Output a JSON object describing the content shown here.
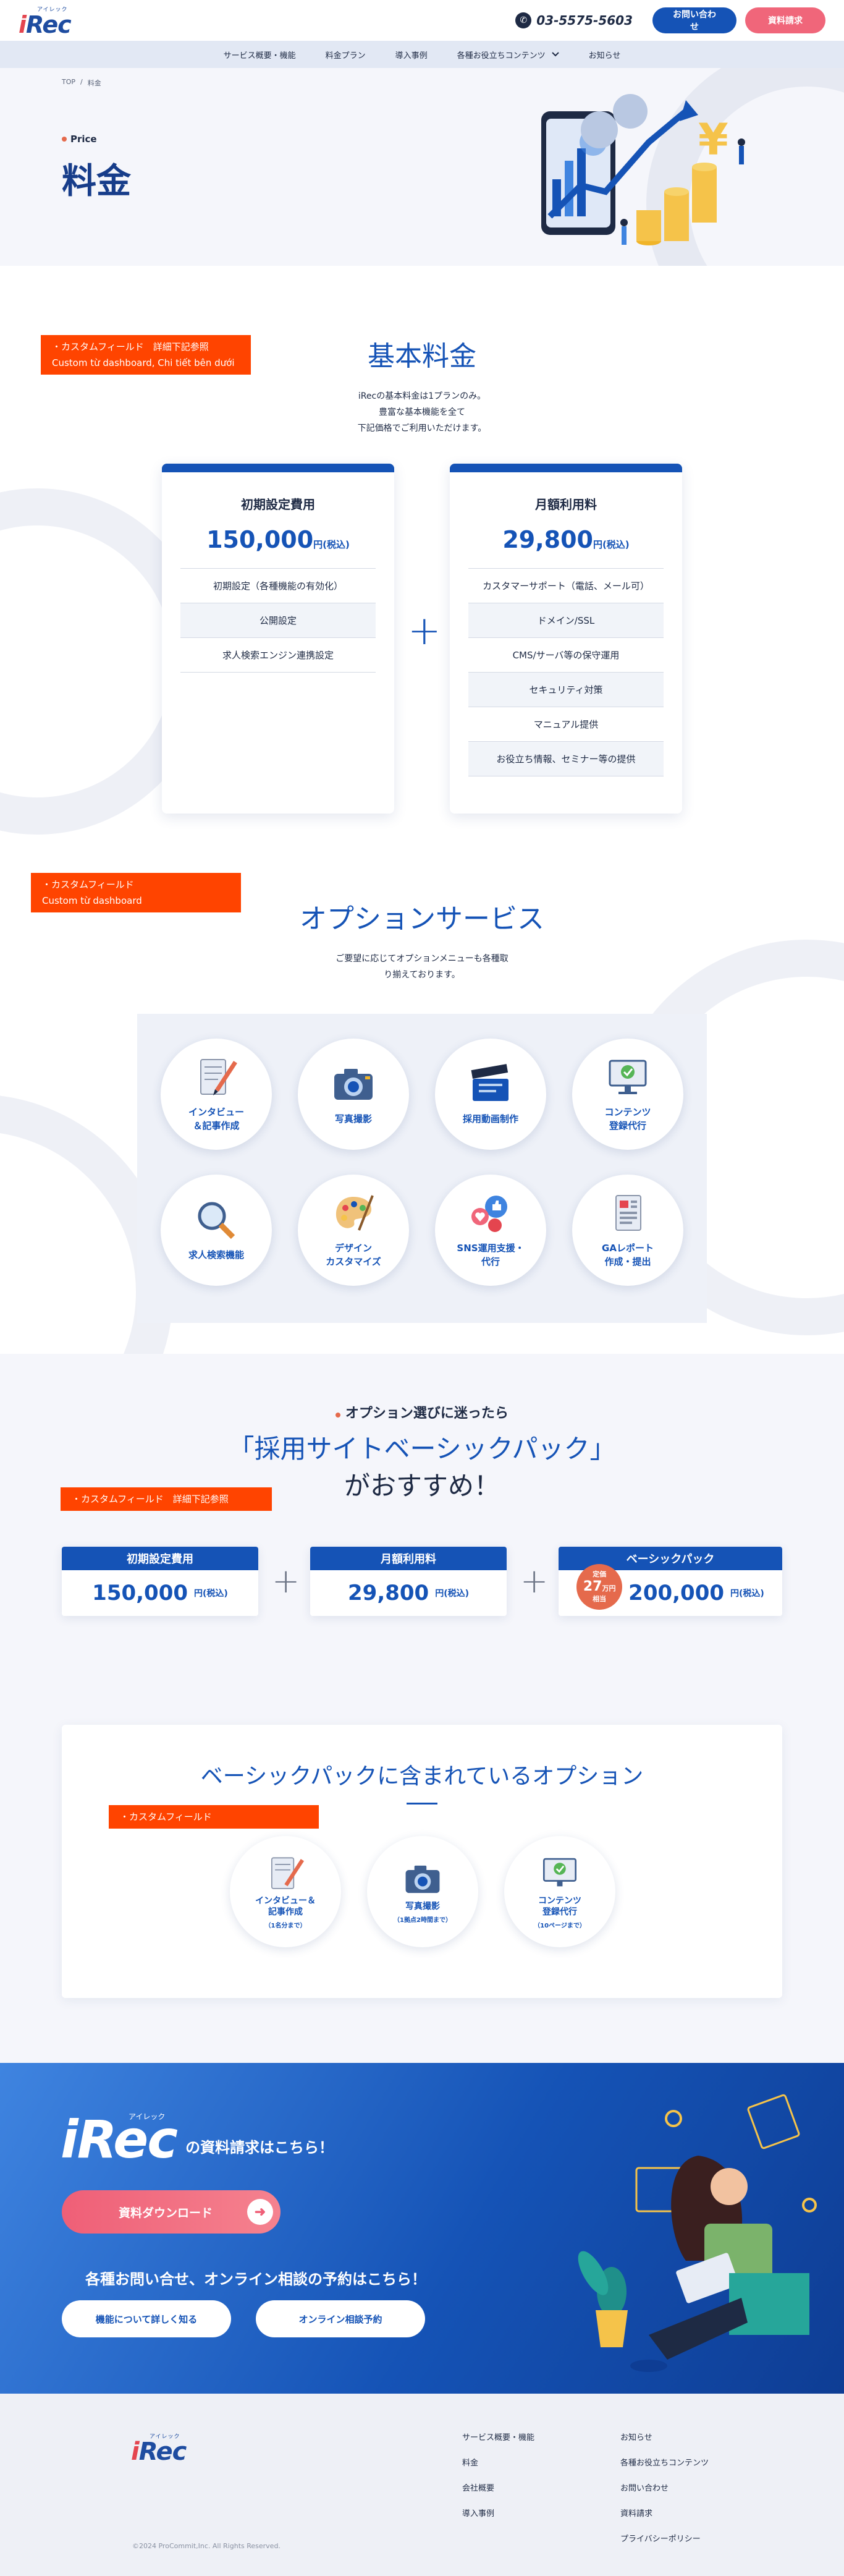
{
  "header": {
    "logo_small": "アイレック",
    "logo_text": "Rec",
    "logo_i": "i",
    "phone": "03-5575-5603",
    "contact_btn": "お問い合わせ",
    "docs_btn": "資料請求"
  },
  "nav": {
    "items": [
      "サービス概要・機能",
      "料金プラン",
      "導入事例",
      "各種お役立ちコンテンツ",
      "お知らせ"
    ]
  },
  "hero": {
    "breadcrumb_top": "TOP",
    "breadcrumb_sep": "/",
    "breadcrumb_current": "料金",
    "eyebrow": "Price",
    "title": "料金"
  },
  "basic": {
    "note": "・カスタムフィールド　詳細下記参照\nCustom từ dashboard, Chi tiết bên dưới",
    "title": "基本料金",
    "desc": "iRecの基本料金は1プランのみ。\n豊富な基本機能を全て\n下記価格でご利用いただけます。",
    "setup": {
      "title": "初期設定費用",
      "price": "150,000",
      "unit": "円(税込)",
      "items": [
        "初期設定（各種機能の有効化）",
        "公開設定",
        "求人検索エンジン連携設定"
      ]
    },
    "plus": "+",
    "monthly": {
      "title": "月額利用料",
      "price": "29,800",
      "unit": "円(税込)",
      "items": [
        "カスタマーサポート（電話、メール可）",
        "ドメイン/SSL",
        "CMS/サーバ等の保守運用",
        "セキュリティ対策",
        "マニュアル提供",
        "お役立ち情報、セミナー等の提供"
      ]
    }
  },
  "options": {
    "note": "・カスタムフィールド\nCustom từ dashboard",
    "title": "オプションサービス",
    "desc": "ご要望に応じてオプションメニューも各種取\nり揃えております。",
    "items": [
      {
        "label": "インタビュー\n＆記事作成",
        "icon": "interview-icon"
      },
      {
        "label": "写真撮影",
        "icon": "camera-icon"
      },
      {
        "label": "採用動画制作",
        "icon": "clapperboard-icon"
      },
      {
        "label": "コンテンツ\n登録代行",
        "icon": "monitor-check-icon"
      },
      {
        "label": "求人検索機能",
        "icon": "magnifier-icon"
      },
      {
        "label": "デザイン\nカスタマイズ",
        "icon": "palette-icon"
      },
      {
        "label": "SNS運用支援・\n代行",
        "icon": "sns-icon"
      },
      {
        "label": "GAレポート\n作成・提出",
        "icon": "report-icon"
      }
    ]
  },
  "pack": {
    "eyebrow": "オプション選びに迷ったら",
    "title_line1": "「採用サイトベーシックパック」",
    "title_line2": "がおすすめ！",
    "note": "・カスタムフィールド　詳細下記参照",
    "boxes": [
      {
        "head": "初期設定費用",
        "price": "150,000",
        "unit": "円(税込)"
      },
      {
        "head": "月額利用料",
        "price": "29,800",
        "unit": "円(税込)"
      },
      {
        "head": "ベーシックパック",
        "price": "200,000",
        "unit": "円(税込)"
      }
    ],
    "badge_top": "定価",
    "badge_value": "27",
    "badge_unit": "万円",
    "badge_bottom": "相当",
    "plus": "+",
    "included_title": "ベーシックパックに含まれているオプション",
    "included_note": "・カスタムフィールド",
    "included": [
      {
        "label": "インタビュー＆\n記事作成",
        "sub": "（1名分まで）",
        "icon": "interview-icon"
      },
      {
        "label": "写真撮影",
        "sub": "（1拠点2時間まで）",
        "icon": "camera-icon"
      },
      {
        "label": "コンテンツ\n登録代行",
        "sub": "（10ページまで）",
        "icon": "monitor-check-icon"
      }
    ]
  },
  "cta": {
    "logo_small": "アイレック",
    "logo_text": "iRec",
    "logo_suffix": "の資料請求はこちら！",
    "download_btn": "資料ダウンロード",
    "contact_text": "各種お問い合せ、オンライン相談の予約はこちら！",
    "features_btn": "機能について詳しく知る",
    "consult_btn": "オンライン相談予約"
  },
  "footer": {
    "col1": [
      "サービス概要・機能",
      "料金",
      "会社概要",
      "導入事例"
    ],
    "col2": [
      "お知らせ",
      "各種お役立ちコンテンツ",
      "お問い合わせ",
      "資料請求",
      "プライバシーポリシー"
    ],
    "copyright": "©2024 ProCommit,Inc. All Rights Reserved."
  },
  "colors": {
    "primary": "#1553b6",
    "accent": "#ff4400",
    "pink": "#f0667a",
    "navy": "#1e2a44"
  }
}
